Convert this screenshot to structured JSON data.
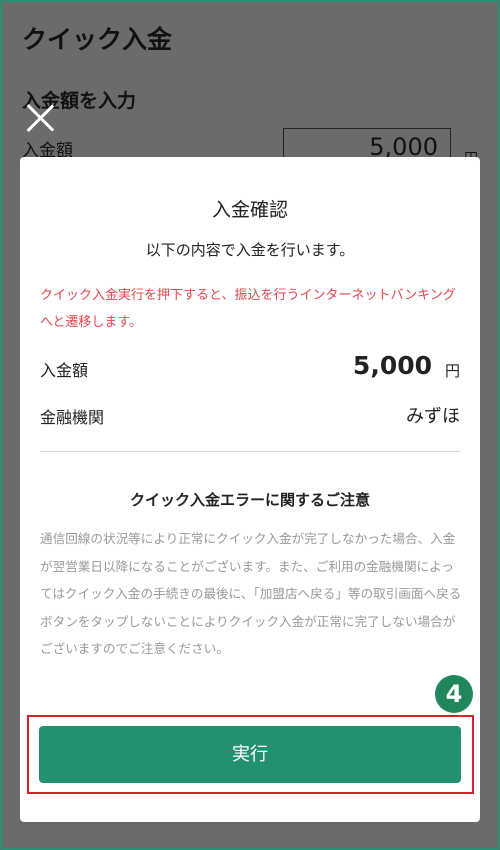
{
  "background_page": {
    "title": "クイック入金",
    "section_title": "入金額を入力",
    "amount_label": "入金額",
    "amount_value": "5,000",
    "amount_unit": "円"
  },
  "modal": {
    "title": "入金確認",
    "lead": "以下の内容で入金を行います。",
    "warning": "クイック入金実行を押下すると、振込を行うインターネットバンキングへと遷移します。",
    "amount_label": "入金額",
    "amount_value": "5,000",
    "amount_unit": "円",
    "bank_label": "金融機関",
    "bank_value": "みずほ",
    "note_title": "クイック入金エラーに関するご注意",
    "note_text": "通信回線の状況等により正常にクイック入金が完了しなかった場合、入金が翌営業日以降になることがございます。また、ご利用の金融機関によってはクイック入金の手続きの最後に、「加盟店へ戻る」等の取引画面へ戻るボタンをタップしないことによりクイック入金が正常に完了しない場合がございますのでご注意ください。",
    "execute_label": "実行"
  },
  "annotation": {
    "step_badge": "4",
    "badge_color": "#22865d",
    "highlight_color": "#d22424"
  },
  "colors": {
    "accent": "#229172",
    "warning": "#e2474f",
    "overlay": "#6b6b6b"
  },
  "icons": {
    "close": "close-icon"
  }
}
